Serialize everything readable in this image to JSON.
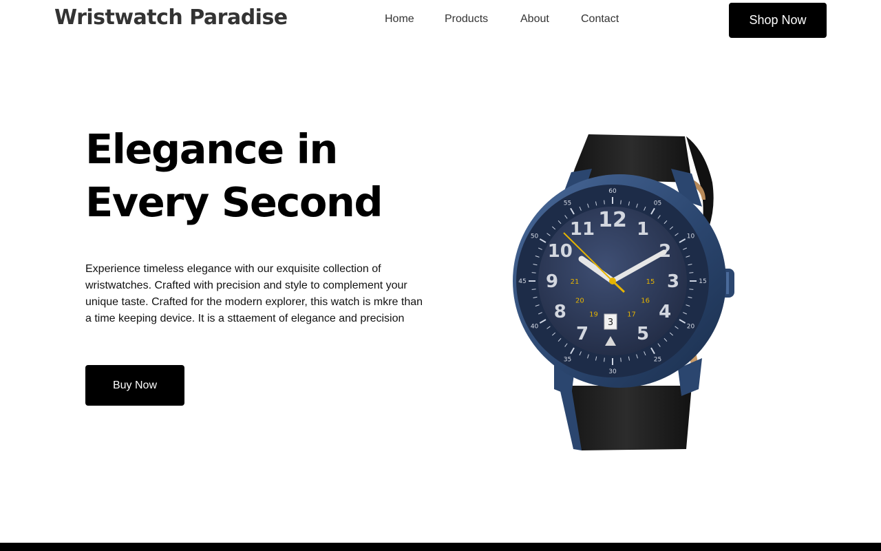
{
  "header": {
    "brand": "Wristwatch Paradise",
    "nav": [
      {
        "label": "Home"
      },
      {
        "label": "Products"
      },
      {
        "label": "About"
      },
      {
        "label": "Contact"
      }
    ],
    "cta_label": "Shop Now"
  },
  "hero": {
    "title_line1": "Elegance in",
    "title_line2": "Every Second",
    "description": "Experience timeless elegance with our exquisite collection of wristwatches. Crafted with precision and style to complement your unique taste. Crafted for the modern explorer, this watch is mkre than a time keeping device. It is a sttaement of elegance and precision",
    "button_label": "Buy Now"
  },
  "watch": {
    "dial_hours": [
      "12",
      "1",
      "2",
      "3",
      "4",
      "5",
      "7",
      "8",
      "9",
      "10",
      "11"
    ],
    "dial_inner": [
      "15",
      "16",
      "17",
      "19",
      "20",
      "21"
    ],
    "bezel_minutes": [
      "60",
      "05",
      "10",
      "15",
      "20",
      "25",
      "30",
      "35",
      "40",
      "45",
      "50",
      "55"
    ],
    "date": "3",
    "colors": {
      "case": "#2e4c78",
      "dial": "#2f3d5e",
      "strap": "#1c1c1c",
      "accent": "#e6b400"
    }
  },
  "theme": {
    "button_bg": "#000000",
    "button_text": "#ffffff",
    "brand_color": "#333333"
  }
}
